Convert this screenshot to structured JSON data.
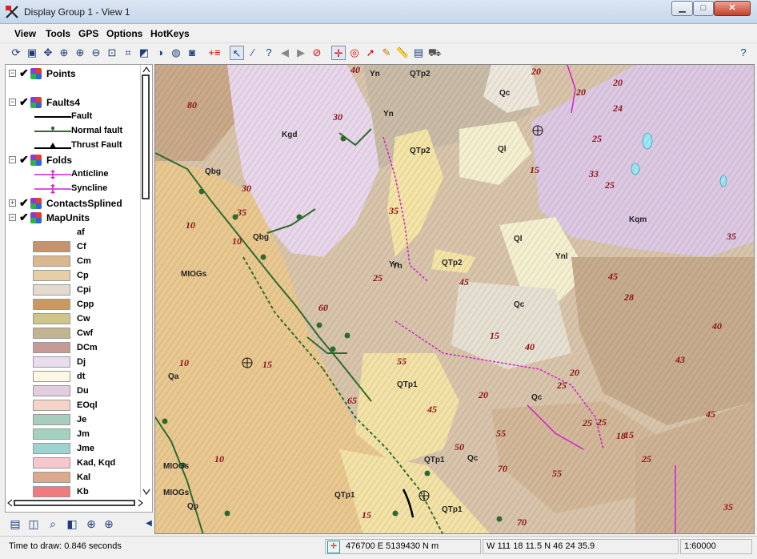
{
  "window": {
    "title": "Display Group 1 - View 1",
    "minimize": "▁",
    "maximize": "□",
    "close": "✕"
  },
  "menu": [
    "View",
    "Tools",
    "GPS",
    "Options",
    "HotKeys"
  ],
  "toolbar": {
    "help": "?"
  },
  "layers": [
    {
      "name": "Points",
      "expander": "−",
      "checked": true
    },
    {
      "name": "Faults4",
      "expander": "−",
      "checked": true
    },
    {
      "name": "Folds",
      "expander": "−",
      "checked": true
    },
    {
      "name": "ContactsSplined",
      "expander": "+",
      "checked": true
    },
    {
      "name": "MapUnits",
      "expander": "−",
      "checked": true
    }
  ],
  "fault_legend": [
    "Fault",
    "Normal fault",
    "Thrust Fault"
  ],
  "fold_legend": [
    "Anticline",
    "Syncline"
  ],
  "map_units": [
    {
      "label": "af",
      "color": "#ffffff"
    },
    {
      "label": "Cf",
      "color": "#c8926a"
    },
    {
      "label": "Cm",
      "color": "#d8b88c"
    },
    {
      "label": "Cp",
      "color": "#e6cfa6"
    },
    {
      "label": "Cpi",
      "color": "#e2dace"
    },
    {
      "label": "Cpp",
      "color": "#c99a60"
    },
    {
      "label": "Cw",
      "color": "#cfc58a"
    },
    {
      "label": "Cwf",
      "color": "#c2b490"
    },
    {
      "label": "DCm",
      "color": "#c89a96"
    },
    {
      "label": "Dj",
      "color": "#e8dcee"
    },
    {
      "label": "dt",
      "color": "#fdf7e4"
    },
    {
      "label": "Du",
      "color": "#e2cce0"
    },
    {
      "label": "EOql",
      "color": "#f6d3c8"
    },
    {
      "label": "Je",
      "color": "#a8ccbe"
    },
    {
      "label": "Jm",
      "color": "#a3d2c0"
    },
    {
      "label": "Jme",
      "color": "#9fd2d2"
    },
    {
      "label": "Kad, Kqd",
      "color": "#f8c6cc"
    },
    {
      "label": "Kal",
      "color": "#dca98c"
    },
    {
      "label": "Kb",
      "color": "#f07a7e"
    }
  ],
  "map": {
    "unit_labels": [
      "Yn",
      "QTp2",
      "Qc",
      "Kgd",
      "Ql",
      "QTp2",
      "Yn",
      "Yn",
      "Kqm",
      "Qbg",
      "Qbg",
      "MIOGs",
      "QTp2",
      "Yn",
      "Ynl",
      "Ql",
      "Qc",
      "Qa",
      "QTp1",
      "Qc",
      "QTp1",
      "MIOGs",
      "MIOGs",
      "Qp",
      "QTp1",
      "Qc",
      "QTp1"
    ],
    "dip_values": [
      "40",
      "80",
      "30",
      "20",
      "20",
      "20",
      "24",
      "25",
      "15",
      "33",
      "25",
      "35",
      "30",
      "35",
      "45",
      "10",
      "10",
      "25",
      "45",
      "15",
      "60",
      "28",
      "35",
      "20",
      "40",
      "15",
      "55",
      "40",
      "43",
      "10",
      "15",
      "20",
      "25",
      "65",
      "25",
      "45",
      "45",
      "25",
      "18",
      "55",
      "50",
      "70",
      "55",
      "25",
      "10",
      "15",
      "70",
      "35"
    ]
  },
  "status": {
    "time_to_draw": "Time to draw: 0.846 seconds",
    "utm": "476700 E  5139430 N m",
    "latlon": "W 111 18 11.5   N 46 24 35.9",
    "scale": "1:60000"
  }
}
